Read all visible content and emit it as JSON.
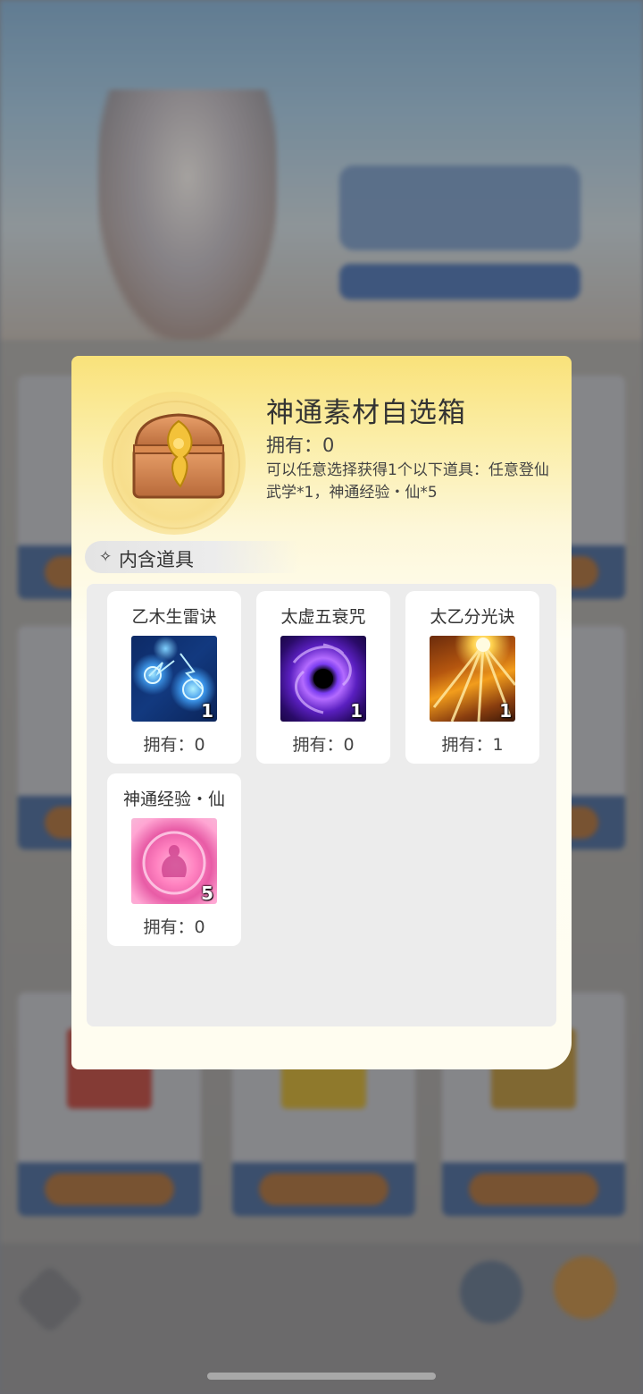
{
  "popup": {
    "title": "神通素材自选箱",
    "own_label": "拥有：",
    "own_value": "0",
    "description": "可以任意选择获得1个以下道具：任意登仙武学*1，神通经验・仙*5",
    "chest_icon": "treasure-chest-icon"
  },
  "section": {
    "diamond_icon": "diamond-icon",
    "title": "内含道具"
  },
  "items": [
    {
      "name": "乙木生雷诀",
      "icon": "lightning-orbs-icon",
      "quantity": "1",
      "owned": "拥有：0"
    },
    {
      "name": "太虚五衰咒",
      "icon": "black-hole-icon",
      "quantity": "1",
      "owned": "拥有：0"
    },
    {
      "name": "太乙分光诀",
      "icon": "light-rays-icon",
      "quantity": "1",
      "owned": "拥有：1"
    },
    {
      "name": "神通经验・仙",
      "icon": "pink-orb-icon",
      "quantity": "5",
      "owned": "拥有：0"
    }
  ],
  "colors": {
    "popup_header": "#f9e27a",
    "popup_body": "#fffdf0",
    "grid_bg": "#ececec"
  }
}
